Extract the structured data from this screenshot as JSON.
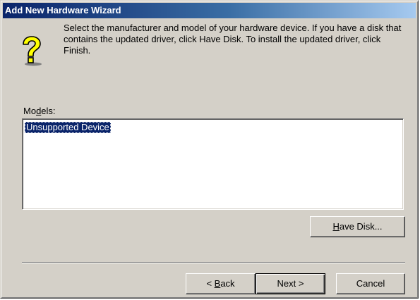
{
  "window": {
    "title": "Add New Hardware Wizard"
  },
  "header": {
    "icon": "question-mark-help-icon",
    "instructions": "Select the manufacturer and model of your hardware device. If you have a disk that contains the updated driver, click Have Disk. To install the updated driver, click Finish."
  },
  "models": {
    "label_pre": "Mo",
    "label_accel": "d",
    "label_post": "els:",
    "items": [
      "Unsupported Device"
    ],
    "selected_index": 0
  },
  "buttons": {
    "have_disk_accel": "H",
    "have_disk_rest": "ave Disk...",
    "back_pre": "< ",
    "back_accel": "B",
    "back_rest": "ack",
    "next_label": "Next >",
    "cancel_label": "Cancel"
  },
  "colors": {
    "face": "#d4d0c8",
    "title_start": "#0a246a",
    "title_end": "#a6caf0",
    "selection": "#0a246a"
  }
}
